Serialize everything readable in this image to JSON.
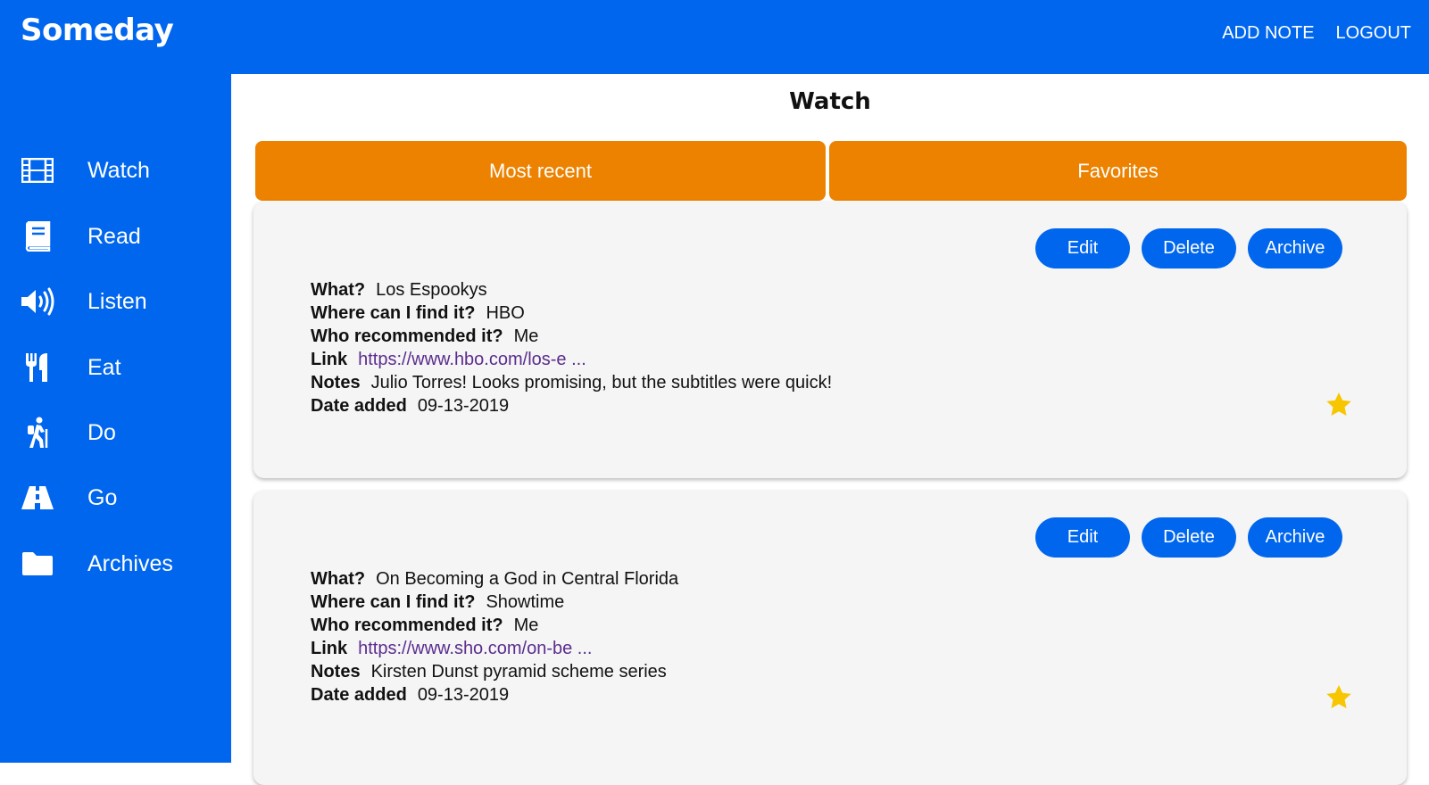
{
  "app": {
    "title": "Someday"
  },
  "topnav": {
    "add_note": "ADD NOTE",
    "logout": "LOGOUT"
  },
  "sidebar": {
    "items": [
      {
        "label": "Watch",
        "icon": "film-icon"
      },
      {
        "label": "Read",
        "icon": "book-icon"
      },
      {
        "label": "Listen",
        "icon": "speaker-icon"
      },
      {
        "label": "Eat",
        "icon": "utensils-icon"
      },
      {
        "label": "Do",
        "icon": "hiking-icon"
      },
      {
        "label": "Go",
        "icon": "road-icon"
      },
      {
        "label": "Archives",
        "icon": "folder-icon"
      }
    ]
  },
  "main": {
    "title": "Watch",
    "tabs": [
      {
        "label": "Most recent"
      },
      {
        "label": "Favorites"
      }
    ]
  },
  "card_actions": {
    "edit": "Edit",
    "delete": "Delete",
    "archive": "Archive"
  },
  "field_labels": {
    "what": "What?",
    "where": "Where can I find it?",
    "who": "Who recommended it?",
    "link": "Link",
    "notes": "Notes",
    "date": "Date added"
  },
  "notes": [
    {
      "what": "Los Espookys",
      "where": "HBO",
      "who": "Me",
      "link": "https://www.hbo.com/los-e ...",
      "notes": "Julio Torres! Looks promising, but the subtitles were quick!",
      "date": "09-13-2019",
      "favorite": true
    },
    {
      "what": "On Becoming a God in Central Florida",
      "where": "Showtime",
      "who": "Me",
      "link": "https://www.sho.com/on-be ...",
      "notes": "Kirsten Dunst pyramid scheme series",
      "date": "09-13-2019",
      "favorite": true
    }
  ],
  "colors": {
    "primary": "#0066ee",
    "accent": "#ec8200",
    "star": "#f7c600",
    "link": "#5b2d8e"
  }
}
